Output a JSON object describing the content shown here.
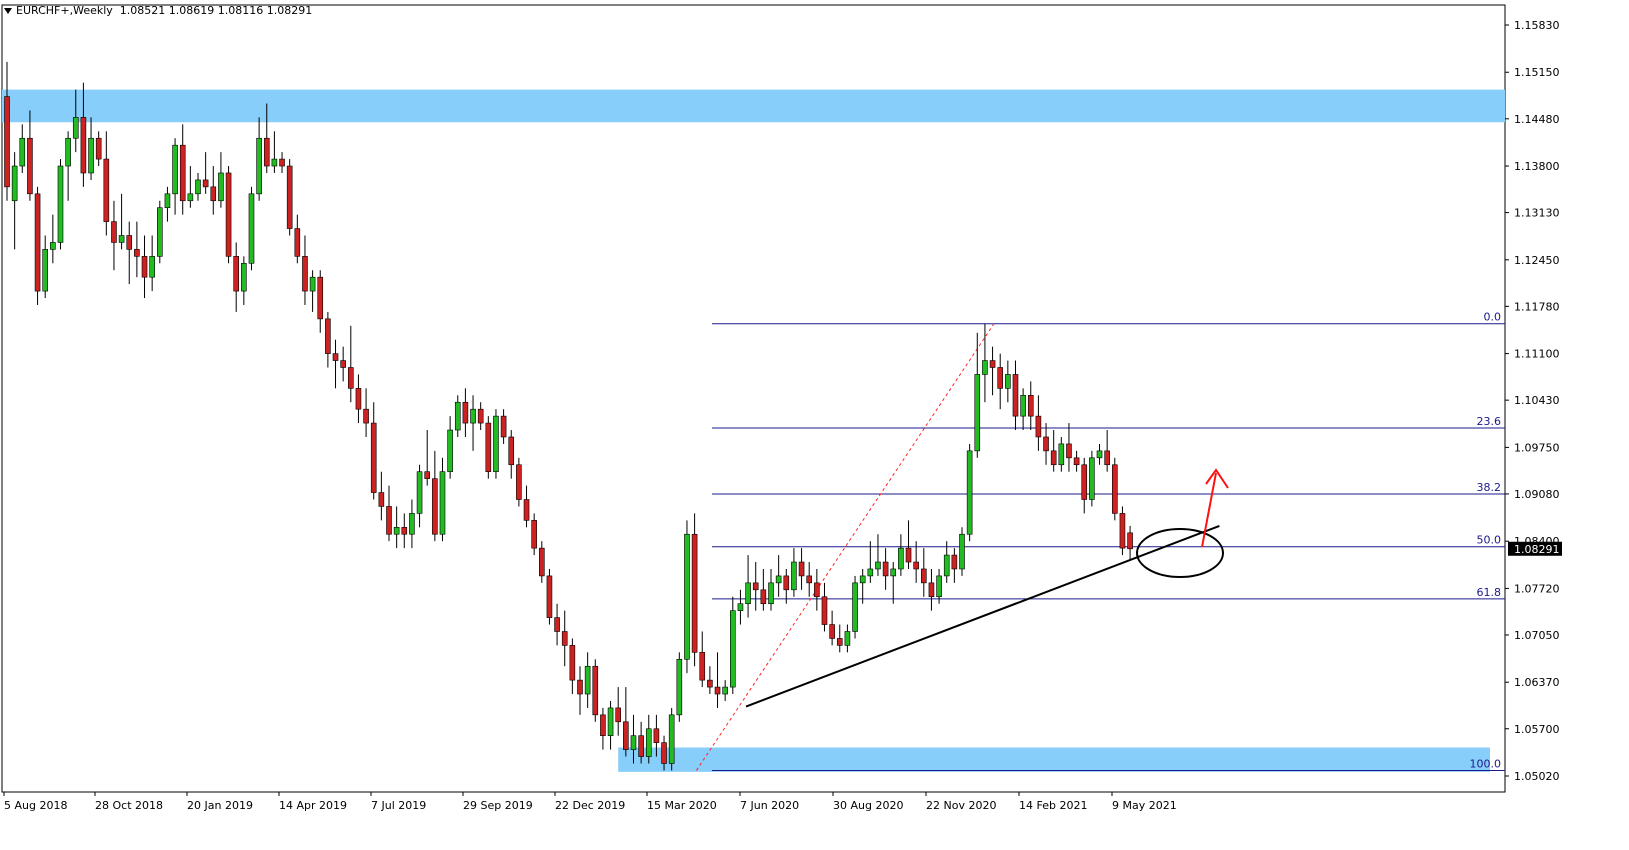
{
  "header": {
    "symbol": "EURCHF+,Weekly",
    "ohlc": "1.08521 1.08619 1.08116 1.08291"
  },
  "colors": {
    "bull": "#22bb22",
    "bear": "#cc2222",
    "zone": "#87cefa",
    "fib": "#1a1a8c",
    "trend": "#000000",
    "dashed": "#ff2222",
    "arrow": "#ff1111",
    "price_tag_bg": "#000000"
  },
  "chart_data": {
    "type": "candlestick",
    "ylim": [
      1.0502,
      1.1583
    ],
    "y_ticks": [
      "1.15830",
      "1.15150",
      "1.14480",
      "1.13800",
      "1.13130",
      "1.12450",
      "1.11780",
      "1.11100",
      "1.10430",
      "1.09750",
      "1.09080",
      "1.08400",
      "1.07720",
      "1.07050",
      "1.06370",
      "1.05700",
      "1.05020"
    ],
    "x_ticks": [
      "5 Aug 2018",
      "28 Oct 2018",
      "20 Jan 2019",
      "14 Apr 2019",
      "7 Jul 2019",
      "29 Sep 2019",
      "22 Dec 2019",
      "15 Mar 2020",
      "7 Jun 2020",
      "30 Aug 2020",
      "22 Nov 2020",
      "14 Feb 2021",
      "9 May 2021"
    ],
    "current_price": "1.08291",
    "fib_levels": [
      {
        "label": "0.0",
        "price": 1.1153
      },
      {
        "label": "23.6",
        "price": 1.1003
      },
      {
        "label": "38.2",
        "price": 1.0908
      },
      {
        "label": "50.0",
        "price": 1.0832
      },
      {
        "label": "61.8",
        "price": 1.0757
      },
      {
        "label": "100.0",
        "price": 1.051
      }
    ],
    "zones": [
      {
        "top": 1.149,
        "bottom": 1.1443,
        "from": 0,
        "to": 1
      },
      {
        "top": 1.0543,
        "bottom": 1.0508,
        "from": 0.41,
        "to": 0.99
      }
    ],
    "trendline": {
      "from": [
        0.495,
        1.0602
      ],
      "to": [
        0.81,
        1.0862
      ]
    },
    "fib_anchor": {
      "from": [
        0.462,
        1.051
      ],
      "to": [
        0.66,
        1.1153
      ]
    },
    "candles": [
      [
        1.148,
        1.153,
        1.133,
        1.135
      ],
      [
        1.133,
        1.14,
        1.126,
        1.138
      ],
      [
        1.138,
        1.144,
        1.137,
        1.142
      ],
      [
        1.142,
        1.146,
        1.133,
        1.134
      ],
      [
        1.134,
        1.135,
        1.118,
        1.12
      ],
      [
        1.12,
        1.128,
        1.119,
        1.126
      ],
      [
        1.126,
        1.131,
        1.124,
        1.127
      ],
      [
        1.127,
        1.139,
        1.126,
        1.138
      ],
      [
        1.138,
        1.143,
        1.133,
        1.142
      ],
      [
        1.142,
        1.149,
        1.14,
        1.145
      ],
      [
        1.145,
        1.15,
        1.135,
        1.137
      ],
      [
        1.137,
        1.145,
        1.136,
        1.142
      ],
      [
        1.142,
        1.143,
        1.138,
        1.139
      ],
      [
        1.139,
        1.143,
        1.128,
        1.13
      ],
      [
        1.13,
        1.133,
        1.123,
        1.127
      ],
      [
        1.127,
        1.134,
        1.126,
        1.128
      ],
      [
        1.128,
        1.13,
        1.121,
        1.126
      ],
      [
        1.126,
        1.13,
        1.122,
        1.125
      ],
      [
        1.125,
        1.128,
        1.119,
        1.122
      ],
      [
        1.122,
        1.128,
        1.12,
        1.125
      ],
      [
        1.125,
        1.133,
        1.124,
        1.132
      ],
      [
        1.132,
        1.135,
        1.13,
        1.134
      ],
      [
        1.134,
        1.142,
        1.131,
        1.141
      ],
      [
        1.141,
        1.144,
        1.131,
        1.133
      ],
      [
        1.133,
        1.138,
        1.132,
        1.134
      ],
      [
        1.134,
        1.137,
        1.133,
        1.136
      ],
      [
        1.136,
        1.14,
        1.134,
        1.135
      ],
      [
        1.135,
        1.138,
        1.131,
        1.133
      ],
      [
        1.133,
        1.14,
        1.132,
        1.137
      ],
      [
        1.137,
        1.138,
        1.124,
        1.125
      ],
      [
        1.125,
        1.127,
        1.117,
        1.12
      ],
      [
        1.12,
        1.125,
        1.118,
        1.124
      ],
      [
        1.124,
        1.135,
        1.123,
        1.134
      ],
      [
        1.134,
        1.145,
        1.133,
        1.142
      ],
      [
        1.142,
        1.147,
        1.137,
        1.138
      ],
      [
        1.138,
        1.143,
        1.137,
        1.139
      ],
      [
        1.139,
        1.14,
        1.137,
        1.138
      ],
      [
        1.138,
        1.139,
        1.128,
        1.129
      ],
      [
        1.129,
        1.131,
        1.124,
        1.125
      ],
      [
        1.125,
        1.128,
        1.118,
        1.12
      ],
      [
        1.12,
        1.123,
        1.117,
        1.122
      ],
      [
        1.122,
        1.123,
        1.114,
        1.116
      ],
      [
        1.116,
        1.117,
        1.109,
        1.111
      ],
      [
        1.111,
        1.113,
        1.106,
        1.11
      ],
      [
        1.11,
        1.112,
        1.107,
        1.109
      ],
      [
        1.109,
        1.115,
        1.104,
        1.106
      ],
      [
        1.106,
        1.108,
        1.101,
        1.103
      ],
      [
        1.103,
        1.106,
        1.099,
        1.101
      ],
      [
        1.101,
        1.104,
        1.09,
        1.091
      ],
      [
        1.091,
        1.094,
        1.087,
        1.089
      ],
      [
        1.089,
        1.092,
        1.084,
        1.085
      ],
      [
        1.085,
        1.089,
        1.083,
        1.086
      ],
      [
        1.086,
        1.088,
        1.083,
        1.085
      ],
      [
        1.085,
        1.09,
        1.083,
        1.088
      ],
      [
        1.088,
        1.095,
        1.086,
        1.094
      ],
      [
        1.094,
        1.1,
        1.092,
        1.093
      ],
      [
        1.093,
        1.097,
        1.084,
        1.085
      ],
      [
        1.085,
        1.096,
        1.084,
        1.094
      ],
      [
        1.094,
        1.102,
        1.093,
        1.1
      ],
      [
        1.1,
        1.105,
        1.099,
        1.104
      ],
      [
        1.104,
        1.106,
        1.099,
        1.101
      ],
      [
        1.101,
        1.105,
        1.097,
        1.103
      ],
      [
        1.103,
        1.104,
        1.1,
        1.101
      ],
      [
        1.101,
        1.102,
        1.093,
        1.094
      ],
      [
        1.094,
        1.103,
        1.093,
        1.102
      ],
      [
        1.102,
        1.103,
        1.098,
        1.099
      ],
      [
        1.099,
        1.1,
        1.093,
        1.095
      ],
      [
        1.095,
        1.096,
        1.089,
        1.09
      ],
      [
        1.09,
        1.092,
        1.086,
        1.087
      ],
      [
        1.087,
        1.088,
        1.082,
        1.083
      ],
      [
        1.083,
        1.084,
        1.078,
        1.079
      ],
      [
        1.079,
        1.08,
        1.072,
        1.073
      ],
      [
        1.073,
        1.075,
        1.069,
        1.071
      ],
      [
        1.071,
        1.074,
        1.066,
        1.069
      ],
      [
        1.069,
        1.07,
        1.062,
        1.064
      ],
      [
        1.064,
        1.066,
        1.059,
        1.062
      ],
      [
        1.062,
        1.068,
        1.06,
        1.066
      ],
      [
        1.066,
        1.067,
        1.058,
        1.059
      ],
      [
        1.059,
        1.06,
        1.054,
        1.056
      ],
      [
        1.056,
        1.061,
        1.054,
        1.06
      ],
      [
        1.06,
        1.063,
        1.056,
        1.058
      ],
      [
        1.058,
        1.063,
        1.053,
        1.054
      ],
      [
        1.054,
        1.059,
        1.052,
        1.056
      ],
      [
        1.056,
        1.058,
        1.052,
        1.053
      ],
      [
        1.053,
        1.059,
        1.052,
        1.057
      ],
      [
        1.057,
        1.059,
        1.053,
        1.055
      ],
      [
        1.055,
        1.056,
        1.051,
        1.052
      ],
      [
        1.052,
        1.06,
        1.051,
        1.059
      ],
      [
        1.059,
        1.068,
        1.058,
        1.067
      ],
      [
        1.067,
        1.087,
        1.065,
        1.085
      ],
      [
        1.085,
        1.088,
        1.066,
        1.068
      ],
      [
        1.068,
        1.071,
        1.063,
        1.064
      ],
      [
        1.064,
        1.066,
        1.062,
        1.063
      ],
      [
        1.063,
        1.068,
        1.06,
        1.062
      ],
      [
        1.062,
        1.064,
        1.061,
        1.063
      ],
      [
        1.063,
        1.076,
        1.062,
        1.074
      ],
      [
        1.074,
        1.077,
        1.072,
        1.075
      ],
      [
        1.075,
        1.082,
        1.073,
        1.078
      ],
      [
        1.078,
        1.081,
        1.074,
        1.077
      ],
      [
        1.077,
        1.08,
        1.074,
        1.075
      ],
      [
        1.075,
        1.08,
        1.074,
        1.078
      ],
      [
        1.078,
        1.082,
        1.076,
        1.079
      ],
      [
        1.079,
        1.08,
        1.075,
        1.077
      ],
      [
        1.077,
        1.083,
        1.076,
        1.081
      ],
      [
        1.081,
        1.083,
        1.077,
        1.079
      ],
      [
        1.079,
        1.081,
        1.076,
        1.078
      ],
      [
        1.078,
        1.08,
        1.074,
        1.076
      ],
      [
        1.076,
        1.078,
        1.071,
        1.072
      ],
      [
        1.072,
        1.074,
        1.069,
        1.07
      ],
      [
        1.07,
        1.072,
        1.068,
        1.069
      ],
      [
        1.069,
        1.072,
        1.068,
        1.071
      ],
      [
        1.071,
        1.079,
        1.07,
        1.078
      ],
      [
        1.078,
        1.08,
        1.075,
        1.079
      ],
      [
        1.079,
        1.084,
        1.078,
        1.08
      ],
      [
        1.08,
        1.085,
        1.079,
        1.081
      ],
      [
        1.081,
        1.083,
        1.077,
        1.079
      ],
      [
        1.079,
        1.081,
        1.075,
        1.08
      ],
      [
        1.08,
        1.085,
        1.079,
        1.083
      ],
      [
        1.083,
        1.087,
        1.08,
        1.081
      ],
      [
        1.081,
        1.084,
        1.078,
        1.08
      ],
      [
        1.08,
        1.083,
        1.076,
        1.078
      ],
      [
        1.078,
        1.08,
        1.074,
        1.076
      ],
      [
        1.076,
        1.08,
        1.075,
        1.079
      ],
      [
        1.079,
        1.084,
        1.078,
        1.082
      ],
      [
        1.082,
        1.083,
        1.078,
        1.08
      ],
      [
        1.08,
        1.086,
        1.079,
        1.085
      ],
      [
        1.085,
        1.098,
        1.084,
        1.097
      ],
      [
        1.097,
        1.114,
        1.096,
        1.108
      ],
      [
        1.108,
        1.1153,
        1.104,
        1.11
      ],
      [
        1.11,
        1.112,
        1.105,
        1.109
      ],
      [
        1.109,
        1.111,
        1.103,
        1.106
      ],
      [
        1.106,
        1.11,
        1.104,
        1.108
      ],
      [
        1.108,
        1.11,
        1.1,
        1.102
      ],
      [
        1.102,
        1.106,
        1.1,
        1.105
      ],
      [
        1.105,
        1.107,
        1.1,
        1.102
      ],
      [
        1.102,
        1.105,
        1.097,
        1.099
      ],
      [
        1.099,
        1.101,
        1.095,
        1.097
      ],
      [
        1.097,
        1.1,
        1.094,
        1.095
      ],
      [
        1.095,
        1.099,
        1.094,
        1.098
      ],
      [
        1.098,
        1.101,
        1.094,
        1.096
      ],
      [
        1.096,
        1.097,
        1.094,
        1.095
      ],
      [
        1.095,
        1.096,
        1.088,
        1.09
      ],
      [
        1.09,
        1.097,
        1.089,
        1.096
      ],
      [
        1.096,
        1.098,
        1.095,
        1.097
      ],
      [
        1.097,
        1.1,
        1.094,
        1.095
      ],
      [
        1.095,
        1.096,
        1.087,
        1.088
      ],
      [
        1.088,
        1.089,
        1.082,
        1.083
      ],
      [
        1.0852,
        1.0862,
        1.0812,
        1.0829
      ]
    ]
  }
}
